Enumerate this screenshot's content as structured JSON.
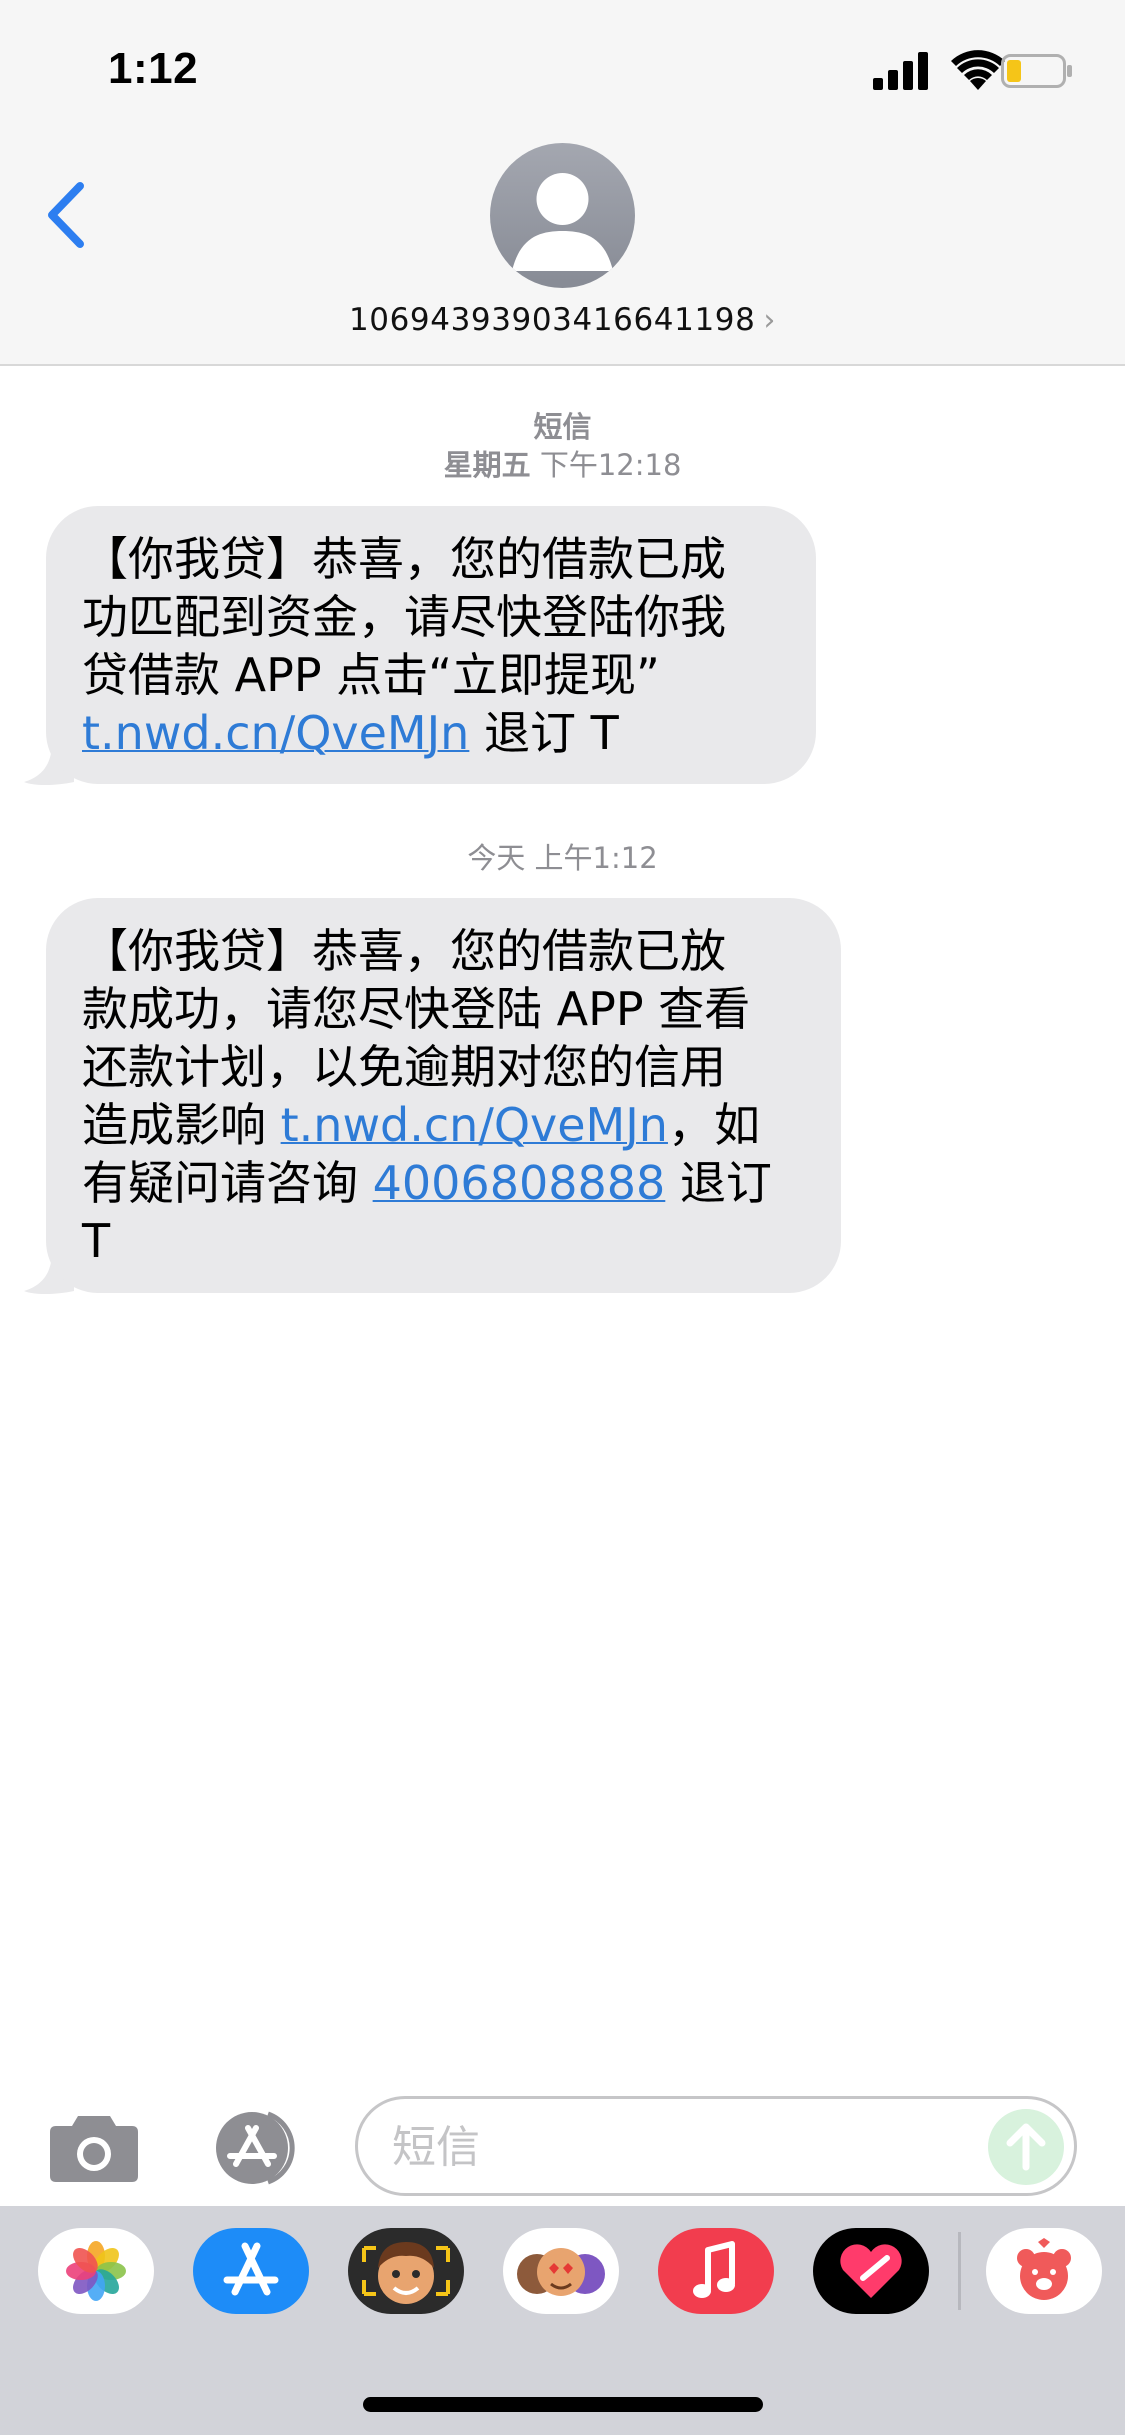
{
  "status_bar": {
    "time": "1:12",
    "icons": [
      "cellular-signal-icon",
      "wifi-icon",
      "battery-icon"
    ],
    "battery_color": "#f5c518"
  },
  "header": {
    "back_icon": "chevron-left-icon",
    "avatar_icon": "person-silhouette-icon",
    "contact_number": "10694393903416641198",
    "chevron": "›"
  },
  "conversation": {
    "channel_label": "短信",
    "messages": [
      {
        "timestamp_day": "星期五",
        "timestamp_time": "下午12:18",
        "lines": [
          "【你我贷】恭喜，您的借款已成",
          "功匹配到资金，请尽快登陆你我",
          "贷借款 APP 点击“立即提现”"
        ],
        "link": "t.nwd.cn/QveMJn",
        "after_link": " 退订 T"
      },
      {
        "timestamp_day": "今天",
        "timestamp_time": "上午1:12",
        "lines": [
          "【你我贷】恭喜，您的借款已放",
          "款成功，请您尽快登陆 APP 查看",
          "还款计划，以免逾期对您的信用"
        ],
        "line4_prefix": "造成影响 ",
        "link": "t.nwd.cn/QveMJn",
        "line4_suffix": "，如",
        "line5_prefix": "有疑问请咨询 ",
        "phone": "4006808888",
        "line5_suffix": " 退订",
        "line6": "T"
      }
    ]
  },
  "input_bar": {
    "camera_icon": "camera-icon",
    "apps_icon": "app-store-icon",
    "placeholder": "短信",
    "send_icon": "arrow-up-icon",
    "send_color": "#d8f2dd"
  },
  "app_drawer": {
    "apps": [
      "photos-icon",
      "app-store-icon",
      "memoji-icon",
      "animoji-stickers-icon",
      "music-icon",
      "digital-touch-icon",
      "bear-sticker-icon"
    ],
    "colors": {
      "app_store": "#1d8cf8",
      "music": "#f23d4e",
      "digital_touch": "#000000"
    }
  },
  "accent_color": "#2e7bd6"
}
